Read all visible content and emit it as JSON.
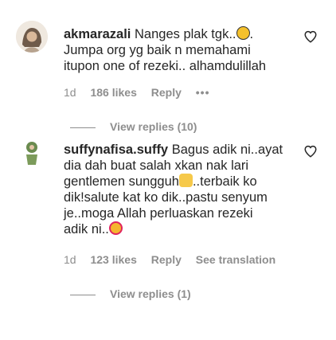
{
  "comments": [
    {
      "username": "akmarazali",
      "text_lines": [
        "Nanges plak tgk..",
        "Jumpa org yg baik n memahami",
        "itupon one of rezeki.. alhamdulillah"
      ],
      "emoji": "😥",
      "time": "1d",
      "likes": "186 likes",
      "reply": "Reply",
      "more": "•••",
      "view_replies": "View replies (10)"
    },
    {
      "username": "suffynafisa.suffy",
      "text_lines": [
        "Bagus adik ni..ayat",
        "dia dah buat salah xkan nak lari",
        "gentlemen sungguh",
        "..terbaik ko",
        "dik!salute kat ko dik..pastu senyum",
        "je..moga Allah perluaskan rezeki",
        "adik ni.."
      ],
      "emoji_thumb": "👍",
      "emoji_smile": "🥰",
      "time": "1d",
      "likes": "123 likes",
      "reply": "Reply",
      "see_translation": "See translation",
      "view_replies": "View replies (1)"
    }
  ],
  "colors": {
    "text": "#262626",
    "secondary": "#8e8e8e",
    "background": "#ffffff"
  },
  "icons": {
    "like": "heart-outline-icon"
  }
}
